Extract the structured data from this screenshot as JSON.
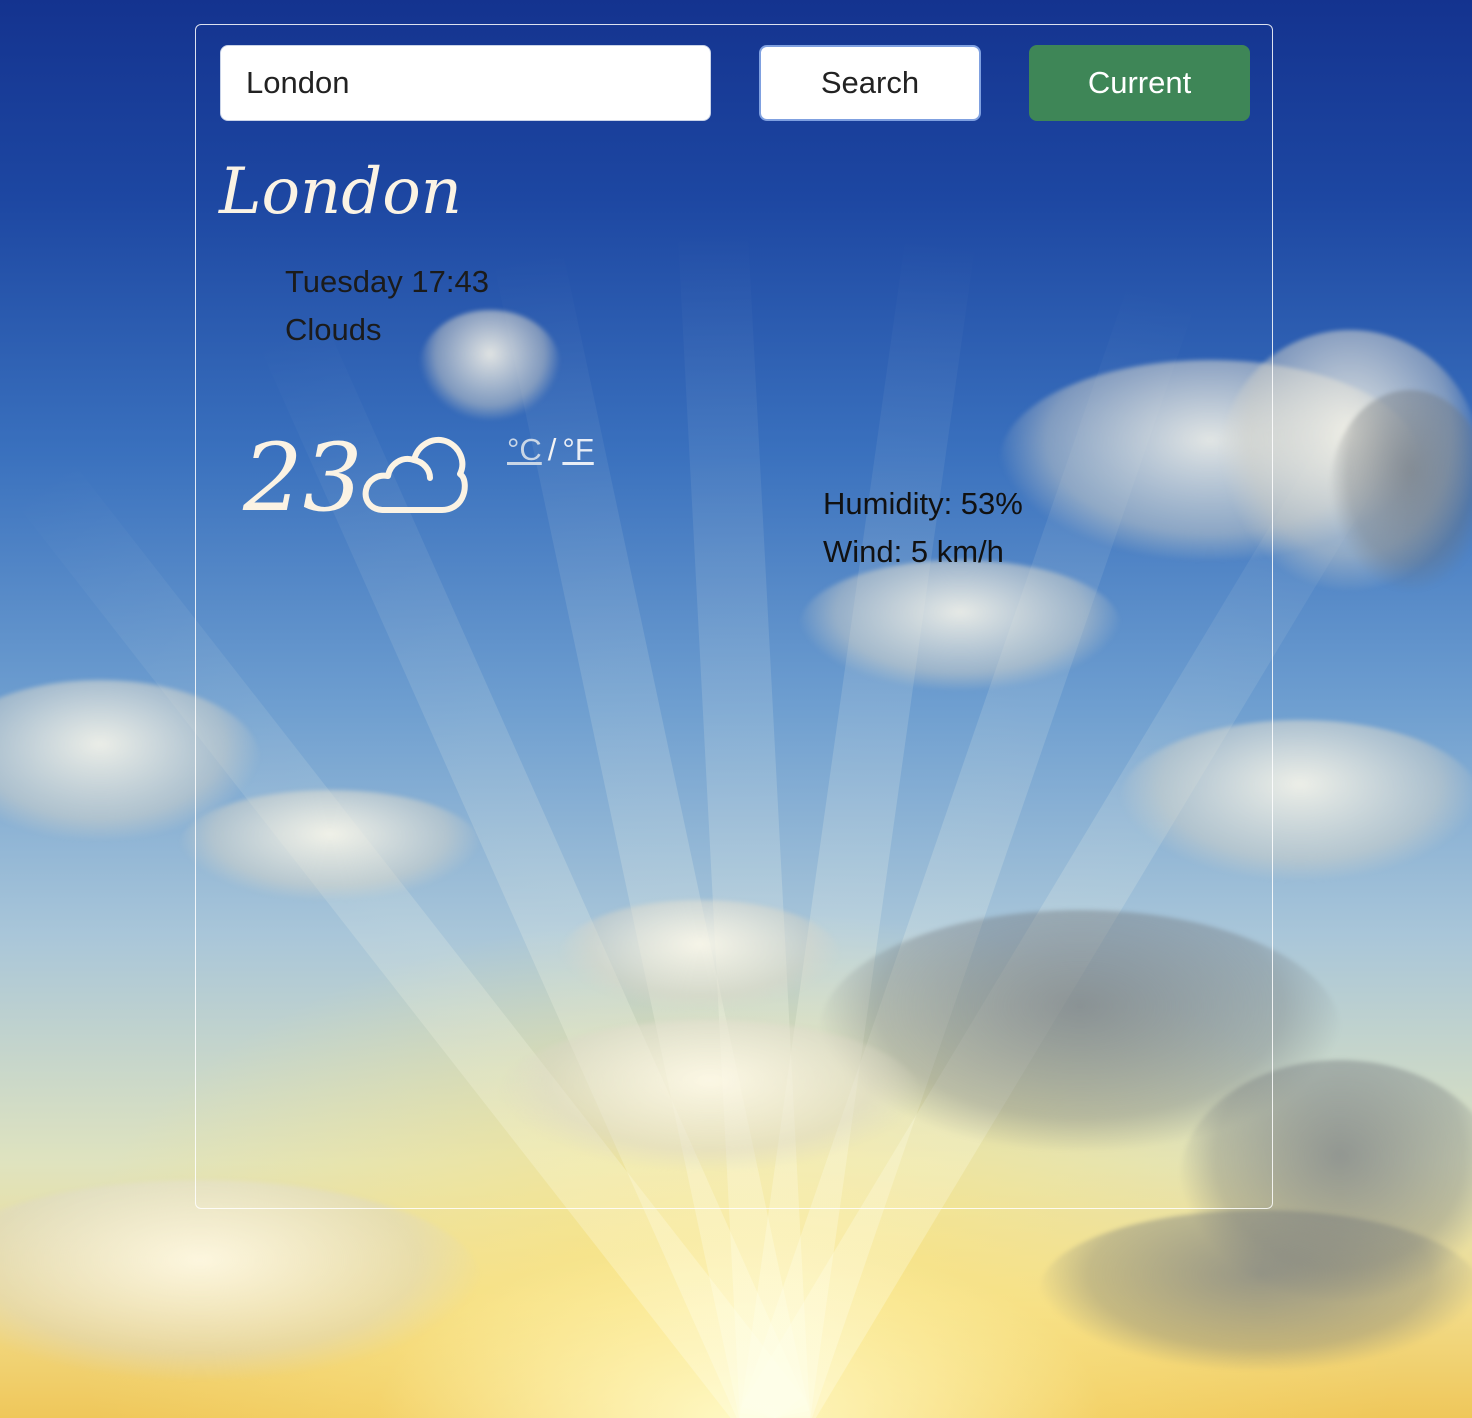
{
  "search": {
    "value": "London",
    "button_label": "Search",
    "current_label": "Current"
  },
  "weather": {
    "city": "London",
    "day_time": "Tuesday 17:43",
    "description": "Clouds",
    "temperature": "23",
    "icon": "cloud-icon",
    "unit_celsius": "°C",
    "unit_separator": "/",
    "unit_fahrenheit": "°F",
    "humidity": "Humidity: 53%",
    "wind": "Wind: 5 km/h"
  },
  "colors": {
    "current_button": "#3e8657",
    "text_light": "#fbf3e4"
  }
}
